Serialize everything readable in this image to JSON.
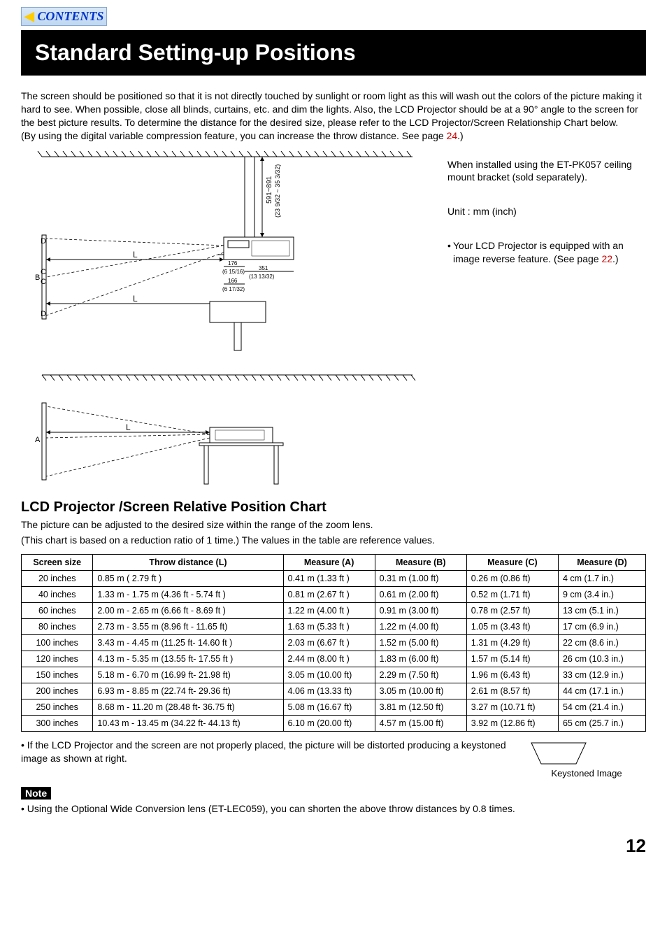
{
  "contents_label": "CONTENTS",
  "title": "Standard Setting-up Positions",
  "intro_p1": "The screen should be positioned so that it is not directly touched by sunlight or room light as this will wash out the colors of the picture making it hard to see. When possible, close all blinds, curtains, etc. and dim the lights. Also, the LCD Projector should be at a 90° angle to the screen for the best picture results. To determine the distance for the desired size, please refer to the LCD Projector/Screen Relationship Chart below.",
  "intro_p2a": "(By using the digital variable compression feature, you can increase the throw distance. See page ",
  "intro_p2_link": "24",
  "intro_p2b": ".)",
  "right": {
    "ceiling": "When installed using the ET-PK057 ceiling mount bracket (sold separately).",
    "unit": "Unit : mm (inch)",
    "reverse_a": "Your LCD Projector is equipped with an image reverse feature. (See page ",
    "reverse_link": "22",
    "reverse_b": ".)"
  },
  "section_heading": "LCD Projector /Screen Relative Position Chart",
  "section_sub1": "The picture can be adjusted to the desired size within the range of the zoom lens.",
  "section_sub2": "(This chart is based on a reduction ratio of 1 time.) The values in the table are reference values.",
  "table": {
    "headers": [
      "Screen size",
      "Throw distance (L)",
      "Measure (A)",
      "Measure (B)",
      "Measure (C)",
      "Measure (D)"
    ],
    "rows": [
      {
        "size": "20 inches",
        "L": "0.85 m            ( 2.79 ft  )",
        "A": "0.41 m (1.33 ft )",
        "B": "0.31 m  (1.00 ft)",
        "C": "0.26 m (0.86 ft)",
        "D": "4 cm   (1.7 in.)"
      },
      {
        "size": "40 inches",
        "L": "1.33 m - 1.75 m    (4.36 ft - 5.74 ft )",
        "A": "0.81 m (2.67 ft )",
        "B": "0.61 m  (2.00 ft)",
        "C": "0.52 m (1.71 ft)",
        "D": "9 cm   (3.4 in.)"
      },
      {
        "size": "60 inches",
        "L": "2.00 m - 2.65 m    (6.66 ft - 8.69 ft )",
        "A": "1.22 m (4.00 ft )",
        "B": "0.91 m  (3.00 ft)",
        "C": "0.78 m (2.57 ft)",
        "D": "13 cm (5.1 in.)"
      },
      {
        "size": "80 inches",
        "L": "2.73 m - 3.55 m    (8.96 ft - 11.65 ft)",
        "A": "1.63 m (5.33 ft )",
        "B": "1.22 m  (4.00 ft)",
        "C": "1.05 m (3.43 ft)",
        "D": "17 cm (6.9 in.)"
      },
      {
        "size": "100 inches",
        "L": "3.43 m - 4.45 m    (11.25 ft- 14.60 ft )",
        "A": "2.03 m (6.67 ft )",
        "B": "1.52 m  (5.00 ft)",
        "C": "1.31 m (4.29 ft)",
        "D": "22 cm (8.6 in.)"
      },
      {
        "size": "120 inches",
        "L": "4.13 m - 5.35 m    (13.55 ft- 17.55 ft )",
        "A": "2.44 m (8.00 ft )",
        "B": "1.83 m  (6.00 ft)",
        "C": "1.57 m (5.14 ft)",
        "D": "26 cm (10.3 in.)"
      },
      {
        "size": "150 inches",
        "L": "5.18 m - 6.70 m    (16.99 ft- 21.98 ft)",
        "A": "3.05 m (10.00 ft)",
        "B": "2.29 m  (7.50 ft)",
        "C": "1.96 m (6.43 ft)",
        "D": "33 cm (12.9 in.)"
      },
      {
        "size": "200 inches",
        "L": "6.93 m - 8.85 m    (22.74 ft- 29.36 ft)",
        "A": "4.06 m (13.33 ft)",
        "B": "3.05 m  (10.00 ft)",
        "C": "2.61 m (8.57 ft)",
        "D": "44 cm (17.1 in.)"
      },
      {
        "size": "250 inches",
        "L": "8.68 m - 11.20 m  (28.48 ft- 36.75 ft)",
        "A": "5.08 m (16.67 ft)",
        "B": "3.81 m  (12.50 ft)",
        "C": "3.27 m (10.71 ft)",
        "D": "54 cm (21.4 in.)"
      },
      {
        "size": "300 inches",
        "L": "10.43 m - 13.45 m (34.22 ft- 44.13 ft)",
        "A": "6.10 m (20.00 ft)",
        "B": "4.57 m  (15.00 ft)",
        "C": "3.92 m (12.86 ft)",
        "D": "65 cm (25.7 in.)"
      }
    ]
  },
  "keystone_text": "If the LCD Projector and the screen are not properly placed, the picture will be distorted producing a keystoned image as shown at right.",
  "keystone_caption": "Keystoned Image",
  "note_label": "Note",
  "note_text": "Using the Optional Wide Conversion lens (ET-LEC059), you can shorten the above throw distances by 0.8 times.",
  "page_number": "12",
  "diagram_labels": {
    "A": "A",
    "B": "B",
    "C": "C",
    "D": "D",
    "L": "L",
    "dim1": "591~891",
    "dim1b": "(23 9/32 ~ 35 3/32)",
    "dim2": "176",
    "dim2b": "(6 15/16)",
    "dim3": "166",
    "dim3b": "(6 17/32)",
    "dim4": "351",
    "dim4b": "(13 13/32)"
  }
}
